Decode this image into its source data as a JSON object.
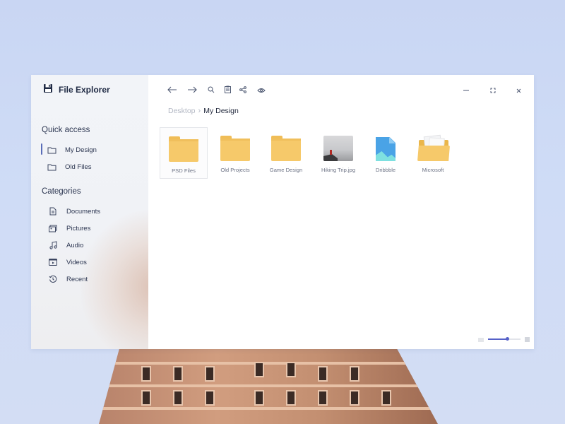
{
  "app": {
    "title": "File Explorer"
  },
  "sidebar": {
    "quick_access_title": "Quick access",
    "quick_access": [
      {
        "label": "My Design",
        "icon": "folder-icon",
        "active": true
      },
      {
        "label": "Old Files",
        "icon": "folder-icon",
        "active": false
      }
    ],
    "categories_title": "Categories",
    "categories": [
      {
        "label": "Documents",
        "icon": "document-icon"
      },
      {
        "label": "Pictures",
        "icon": "pictures-icon"
      },
      {
        "label": "Audio",
        "icon": "music-note-icon"
      },
      {
        "label": "Videos",
        "icon": "video-icon"
      },
      {
        "label": "Recent",
        "icon": "history-icon"
      }
    ]
  },
  "toolbar": {
    "buttons": [
      "back-arrow-icon",
      "forward-arrow-icon",
      "search-icon",
      "clipboard-icon",
      "share-icon",
      "eye-icon"
    ],
    "window_controls": [
      "minimize-icon",
      "maximize-icon",
      "close-icon"
    ]
  },
  "breadcrumb": {
    "root": "Desktop",
    "current": "My Design"
  },
  "files": [
    {
      "name": "PSD Files",
      "type": "folder",
      "selected": true
    },
    {
      "name": "Old Projects",
      "type": "folder",
      "selected": false
    },
    {
      "name": "Game Design",
      "type": "folder",
      "selected": false
    },
    {
      "name": "Hiking Trip.jpg",
      "type": "image",
      "selected": false
    },
    {
      "name": "Dribbble",
      "type": "image-file",
      "selected": false
    },
    {
      "name": "Microsoft",
      "type": "open-folder",
      "selected": false
    }
  ],
  "status": {
    "view_icon": "list-view-icon",
    "grid_icon": "grid-view-icon",
    "zoom_fraction": 0.58
  },
  "colors": {
    "accent": "#5661c8",
    "folder": "#f6c96a",
    "text": "#22293d",
    "muted": "#b3b8c4"
  }
}
